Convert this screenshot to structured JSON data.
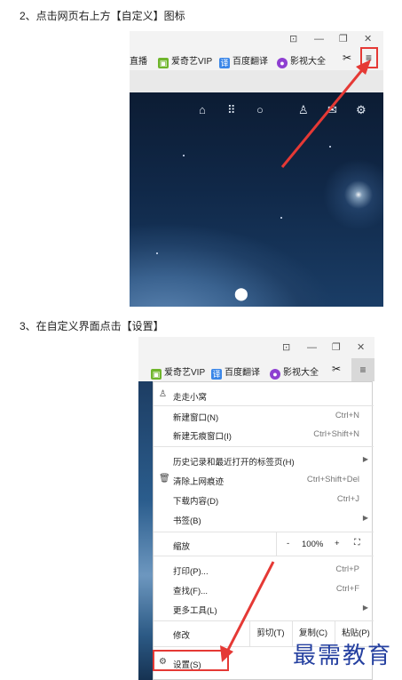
{
  "steps": {
    "step2": "2、点击网页右上方【自定义】图标",
    "step3": "3、在自定义界面点击【设置】"
  },
  "shot1": {
    "bookmarks": [
      "直播",
      "爱奇艺VIP",
      "百度翻译",
      "影视大全"
    ],
    "bookmark_icons": [
      "iqiyi-icon",
      "translate-icon",
      "video-icon"
    ],
    "nav_icons": [
      "home-icon",
      "apps-icon",
      "search-icon",
      "user-icon",
      "mail-icon",
      "settings-icon"
    ]
  },
  "shot2": {
    "bookmarks": [
      "爱奇艺VIP",
      "百度翻译",
      "影视大全"
    ],
    "menu": {
      "account": "走走小窝",
      "new_window": {
        "label": "新建窗口(N)",
        "shortcut": "Ctrl+N"
      },
      "new_incognito": {
        "label": "新建无痕窗口(I)",
        "shortcut": "Ctrl+Shift+N"
      },
      "history": {
        "label": "历史记录和最近打开的标签页(H)"
      },
      "clear": {
        "label": "清除上网痕迹",
        "shortcut": "Ctrl+Shift+Del"
      },
      "downloads": {
        "label": "下载内容(D)",
        "shortcut": "Ctrl+J"
      },
      "bookmarks": {
        "label": "书签(B)"
      },
      "zoom": {
        "label": "缩放",
        "minus": "-",
        "value": "100%",
        "plus": "+",
        "fullscreen": "⛶"
      },
      "print": {
        "label": "打印(P)...",
        "shortcut": "Ctrl+P"
      },
      "find": {
        "label": "查找(F)...",
        "shortcut": "Ctrl+F"
      },
      "more_tools": {
        "label": "更多工具(L)"
      },
      "edit": {
        "label": "修改",
        "cut": "剪切(T)",
        "copy": "复制(C)",
        "paste": "粘贴(P)"
      },
      "settings": {
        "label": "设置(S)"
      }
    }
  },
  "watermark": "最需教育",
  "colors": {
    "highlight": "#e53935",
    "watermark": "#2540a0"
  }
}
